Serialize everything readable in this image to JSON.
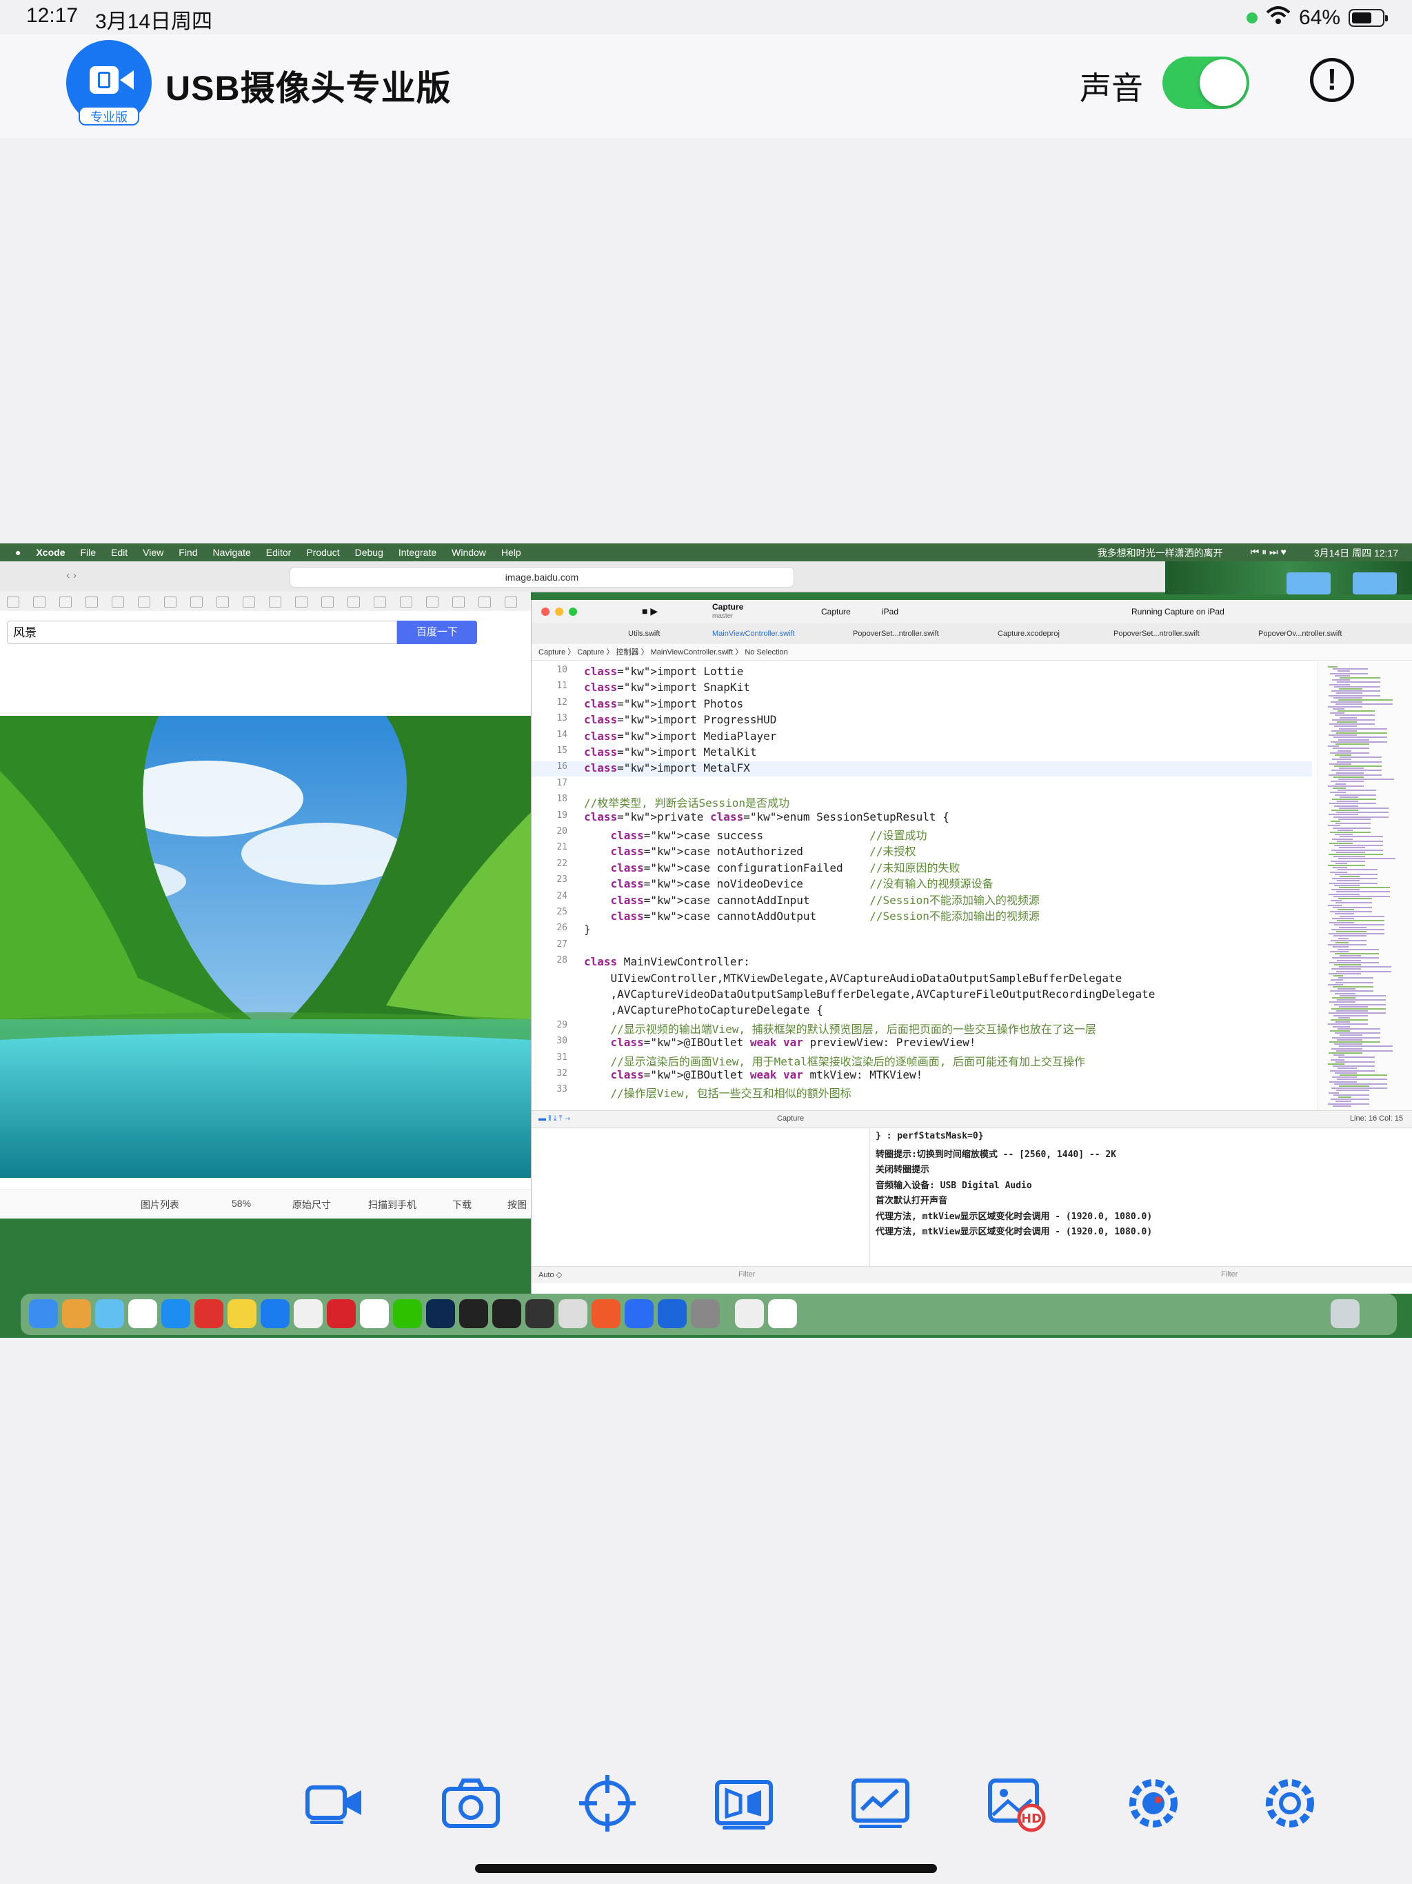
{
  "status_bar": {
    "time": "12:17",
    "date": "3月14日周四",
    "battery": "64%"
  },
  "header": {
    "logo_badge": "专业版",
    "title": "USB摄像头专业版",
    "sound_label": "声音",
    "sound_on": true
  },
  "mac": {
    "menubar": {
      "items": [
        "Xcode",
        "File",
        "Edit",
        "View",
        "Find",
        "Navigate",
        "Editor",
        "Product",
        "Debug",
        "Integrate",
        "Window",
        "Help"
      ],
      "now_playing": "我多想和时光一样潇洒的离开",
      "clock": "3月14日 周四 12:17"
    },
    "browser": {
      "url": "image.baidu.com",
      "search_value": "风景",
      "search_button": "百度一下",
      "img_toolbar": {
        "list": "图片列表",
        "zoom": "58%",
        "original": "原始尺寸",
        "scan": "扫描到手机",
        "download": "下载",
        "more": "按图"
      }
    },
    "xcode": {
      "scheme": "Capture",
      "branch": "master",
      "destination_scheme": "Capture",
      "destination_device": "iPad",
      "status": "Running Capture on iPad",
      "tabs": [
        "Utils.swift",
        "MainViewController.swift",
        "PopoverSet...ntroller.swift",
        "Capture.xcodeproj",
        "PopoverSet...ntroller.swift",
        "PopoverOv...ntroller.swift"
      ],
      "breadcrumb": "Capture 〉 Capture 〉 控制器 〉 MainViewController.swift 〉 No Selection",
      "code": [
        {
          "n": "10",
          "t": "import Lottie"
        },
        {
          "n": "11",
          "t": "import SnapKit"
        },
        {
          "n": "12",
          "t": "import Photos"
        },
        {
          "n": "13",
          "t": "import ProgressHUD"
        },
        {
          "n": "14",
          "t": "import MediaPlayer"
        },
        {
          "n": "15",
          "t": "import MetalKit"
        },
        {
          "n": "16",
          "t": "import MetalFX"
        },
        {
          "n": "17",
          "t": ""
        },
        {
          "n": "18",
          "t": "//枚举类型, 判断会话Session是否成功"
        },
        {
          "n": "19",
          "t": "private enum SessionSetupResult {"
        },
        {
          "n": "20",
          "t": "    case success                //设置成功"
        },
        {
          "n": "21",
          "t": "    case notAuthorized          //未授权"
        },
        {
          "n": "22",
          "t": "    case configurationFailed    //未知原因的失败"
        },
        {
          "n": "23",
          "t": "    case noVideoDevice          //没有输入的视频源设备"
        },
        {
          "n": "24",
          "t": "    case cannotAddInput         //Session不能添加输入的视频源"
        },
        {
          "n": "25",
          "t": "    case cannotAddOutput        //Session不能添加输出的视频源"
        },
        {
          "n": "26",
          "t": "}"
        },
        {
          "n": "27",
          "t": ""
        },
        {
          "n": "28",
          "t": "class MainViewController:"
        },
        {
          "n": "",
          "t": "    UIViewController,MTKViewDelegate,AVCaptureAudioDataOutputSampleBufferDelegate"
        },
        {
          "n": "",
          "t": "    ,AVCaptureVideoDataOutputSampleBufferDelegate,AVCaptureFileOutputRecordingDelegate"
        },
        {
          "n": "",
          "t": "    ,AVCapturePhotoCaptureDelegate {"
        },
        {
          "n": "29",
          "t": "    //显示视频的输出端View, 捕获框架的默认预览图层, 后面把页面的一些交互操作也放在了这一层"
        },
        {
          "n": "30",
          "t": "    @IBOutlet weak var previewView: PreviewView!"
        },
        {
          "n": "31",
          "t": "    //显示渲染后的画面View, 用于Metal框架接收渲染后的逐帧画面, 后面可能还有加上交互操作"
        },
        {
          "n": "32",
          "t": "    @IBOutlet weak var mtkView: MTKView!"
        },
        {
          "n": "33",
          "t": "    //操作层View, 包括一些交互和相似的额外图标"
        }
      ],
      "debug_target": "Capture",
      "cursor": "Line: 16  Col: 15",
      "console": [
        "} : perfStatsMask=0}",
        "转圈提示:切换到时间缩放模式 -- [2560, 1440] -- 2K",
        "关闭转圈提示",
        "音频输入设备: USB Digital Audio",
        "首次默认打开声音",
        "代理方法, mtkView显示区域变化时会调用 - (1920.0, 1080.0)",
        "代理方法, mtkView显示区域变化时会调用 - (1920.0, 1080.0)"
      ],
      "auto_label": "Auto ◇",
      "filter_placeholder": "Filter"
    }
  },
  "toolbar": {
    "buttons": [
      "video-record",
      "camera",
      "crosshair",
      "mirror",
      "chart",
      "gallery",
      "color-settings",
      "settings"
    ],
    "accent": "#1f6fe6"
  }
}
